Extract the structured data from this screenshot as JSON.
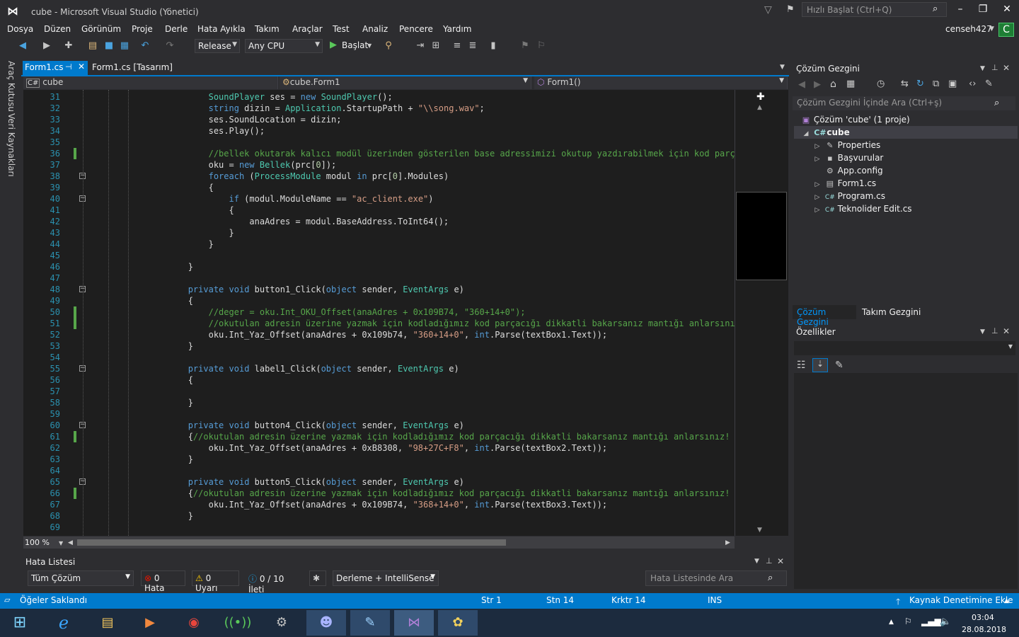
{
  "window": {
    "title": "cube - Microsoft Visual Studio  (Yönetici)",
    "quick_launch_placeholder": "Hızlı Başlat (Ctrl+Q)",
    "user": "censeh427",
    "user_badge": "C"
  },
  "menu": [
    "Dosya",
    "Düzen",
    "Görünüm",
    "Proje",
    "Derle",
    "Hata Ayıkla",
    "Takım",
    "Araçlar",
    "Test",
    "Analiz",
    "Pencere",
    "Yardım"
  ],
  "toolbar": {
    "config": "Release",
    "platform": "Any CPU",
    "start_label": "Başlat"
  },
  "left_tabs": [
    "Araç Kutusu",
    "Veri Kaynakları"
  ],
  "doc_tabs": {
    "active": "Form1.cs",
    "second": "Form1.cs [Tasarım]"
  },
  "nav": {
    "project": "cube",
    "class": "cube.Form1",
    "member": "Form1()"
  },
  "code": {
    "lines": [
      {
        "n": "31",
        "html": "                <span class='t'>SoundPlayer</span> ses = <span class='k'>new</span> <span class='t'>SoundPlayer</span>();"
      },
      {
        "n": "32",
        "html": "                <span class='k'>string</span> dizin = <span class='t'>Application</span>.StartupPath + <span class='s'>\"\\\\song.wav\"</span>;"
      },
      {
        "n": "33",
        "html": "                ses.SoundLocation = dizin;"
      },
      {
        "n": "34",
        "html": "                ses.Play();"
      },
      {
        "n": "35",
        "html": ""
      },
      {
        "n": "36",
        "html": "                <span class='c'>//bellek okutarak kalıcı modül üzerinden gösterilen base adressimizi okutup yazdırabilmek için kod parçacağımız.</span>"
      },
      {
        "n": "37",
        "html": "                oku = <span class='k'>new</span> <span class='t'>Bellek</span>(prc[<span class='n'>0</span>]);"
      },
      {
        "n": "38",
        "html": "                <span class='k'>foreach</span> (<span class='t'>ProcessModule</span> modul <span class='k'>in</span> prc[<span class='n'>0</span>].Modules)"
      },
      {
        "n": "39",
        "html": "                {"
      },
      {
        "n": "40",
        "html": "                    <span class='k'>if</span> (modul.ModuleName == <span class='s'>\"ac_client.exe\"</span>)"
      },
      {
        "n": "41",
        "html": "                    {"
      },
      {
        "n": "42",
        "html": "                        anaAdres = modul.BaseAddress.ToInt64();"
      },
      {
        "n": "43",
        "html": "                    }"
      },
      {
        "n": "44",
        "html": "                }"
      },
      {
        "n": "45",
        "html": ""
      },
      {
        "n": "46",
        "html": "            }"
      },
      {
        "n": "47",
        "html": ""
      },
      {
        "n": "48",
        "html": "            <span class='k'>private</span> <span class='k'>void</span> button1_Click(<span class='k'>object</span> sender, <span class='t'>EventArgs</span> e)"
      },
      {
        "n": "49",
        "html": "            {"
      },
      {
        "n": "50",
        "html": "                <span class='c'>//deger = oku.Int_OKU_Offset(anaAdres + 0x109B74, \"360+14+0\");</span>"
      },
      {
        "n": "51",
        "html": "                <span class='c'>//okutulan adresin üzerine yazmak için kodladığımız kod parçacığı dikkatli bakarsanız mantığı anlarsınız! ;)</span>"
      },
      {
        "n": "52",
        "html": "                oku.Int_Yaz_Offset(anaAdres + 0x109b74, <span class='s'>\"360+14+0\"</span>, <span class='k'>int</span>.Parse(textBox1.Text));"
      },
      {
        "n": "53",
        "html": "            }"
      },
      {
        "n": "54",
        "html": ""
      },
      {
        "n": "55",
        "html": "            <span class='k'>private</span> <span class='k'>void</span> label1_Click(<span class='k'>object</span> sender, <span class='t'>EventArgs</span> e)"
      },
      {
        "n": "56",
        "html": "            {"
      },
      {
        "n": "57",
        "html": ""
      },
      {
        "n": "58",
        "html": "            }"
      },
      {
        "n": "59",
        "html": ""
      },
      {
        "n": "60",
        "html": "            <span class='k'>private</span> <span class='k'>void</span> button4_Click(<span class='k'>object</span> sender, <span class='t'>EventArgs</span> e)"
      },
      {
        "n": "61",
        "html": "            {<span class='c'>//okutulan adresin üzerine yazmak için kodladığımız kod parçacığı dikkatli bakarsanız mantığı anlarsınız! ;)</span>"
      },
      {
        "n": "62",
        "html": "                oku.Int_Yaz_Offset(anaAdres + 0xB8308, <span class='s'>\"98+27C+F8\"</span>, <span class='k'>int</span>.Parse(textBox2.Text));"
      },
      {
        "n": "63",
        "html": "            }"
      },
      {
        "n": "64",
        "html": ""
      },
      {
        "n": "65",
        "html": "            <span class='k'>private</span> <span class='k'>void</span> button5_Click(<span class='k'>object</span> sender, <span class='t'>EventArgs</span> e)"
      },
      {
        "n": "66",
        "html": "            {<span class='c'>//okutulan adresin üzerine yazmak için kodladığımız kod parçacığı dikkatli bakarsanız mantığı anlarsınız! ;)</span>"
      },
      {
        "n": "67",
        "html": "                oku.Int_Yaz_Offset(anaAdres + 0x109B74, <span class='s'>\"368+14+0\"</span>, <span class='k'>int</span>.Parse(textBox3.Text));"
      },
      {
        "n": "68",
        "html": "            }"
      },
      {
        "n": "69",
        "html": ""
      }
    ],
    "zoom": "100 %"
  },
  "error_list": {
    "title": "Hata Listesi",
    "scope": "Tüm Çözüm",
    "errors": "0 Hata",
    "warnings": "0 Uyarı",
    "messages": "0 / 10 İleti",
    "build_filter": "Derleme + IntelliSense",
    "search_placeholder": "Hata Listesinde Ara"
  },
  "solution_explorer": {
    "title": "Çözüm Gezgini",
    "search_placeholder": "Çözüm Gezgini İçinde Ara (Ctrl+ş)",
    "solution": "Çözüm 'cube' (1 proje)",
    "project": "cube",
    "items": [
      "Properties",
      "Başvurular",
      "App.config",
      "Form1.cs",
      "Program.cs",
      "Teknolider Edit.cs"
    ],
    "tab_active": "Çözüm Gezgini",
    "tab_second": "Takım Gezgini"
  },
  "properties": {
    "title": "Özellikler"
  },
  "status": {
    "message": "Öğeler Saklandı",
    "line": "Str 1",
    "col": "Stn 14",
    "char": "Krktr 14",
    "mode": "INS",
    "source_control": "Kaynak Denetimine Ekle"
  },
  "taskbar": {
    "time": "03:04",
    "date": "28.08.2018"
  },
  "colors": {
    "accent": "#007acc",
    "keyword": "#569cd6",
    "type": "#4ec9b0",
    "string": "#d69d85",
    "comment": "#57a64a"
  }
}
